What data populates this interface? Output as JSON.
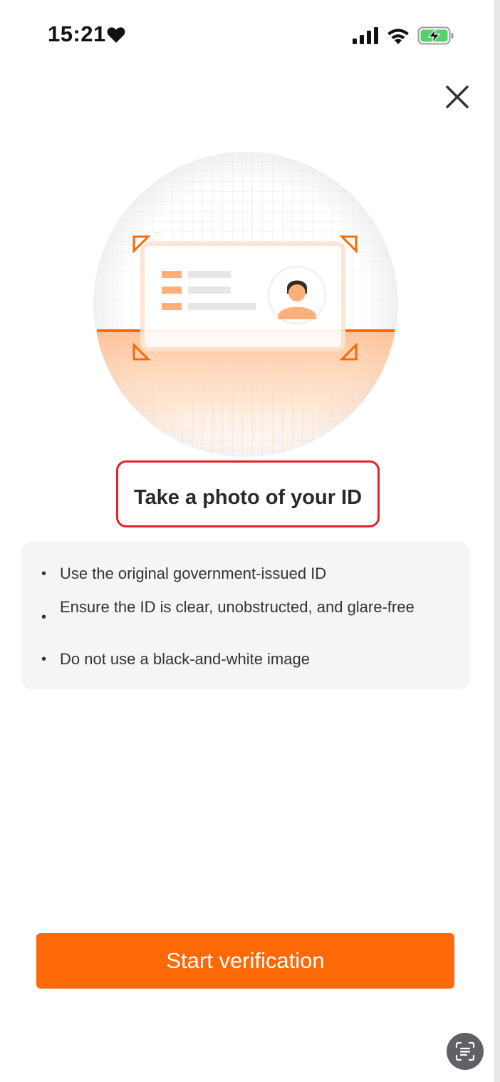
{
  "status_bar": {
    "time": "15:21",
    "heart_icon": "heart-icon",
    "signal_icon": "cellular-signal-icon",
    "wifi_icon": "wifi-icon",
    "battery_icon": "battery-charging-icon"
  },
  "header": {
    "close_icon": "close-icon"
  },
  "illustration": {
    "description_icon": "id-card-scan-illustration",
    "accent_color": "#fd6906"
  },
  "title": "Take a photo of your ID",
  "tips": [
    {
      "bullet": "•",
      "text": "Use the original government-issued ID"
    },
    {
      "bullet": "•",
      "text": "Ensure the ID is clear, unobstructed, and glare-free"
    },
    {
      "bullet": "•",
      "text": "Do not use a black-and-white image"
    }
  ],
  "primary_button": {
    "label": "Start verification",
    "color": "#fd6906"
  },
  "floating_button": {
    "icon": "text-scan-icon"
  }
}
